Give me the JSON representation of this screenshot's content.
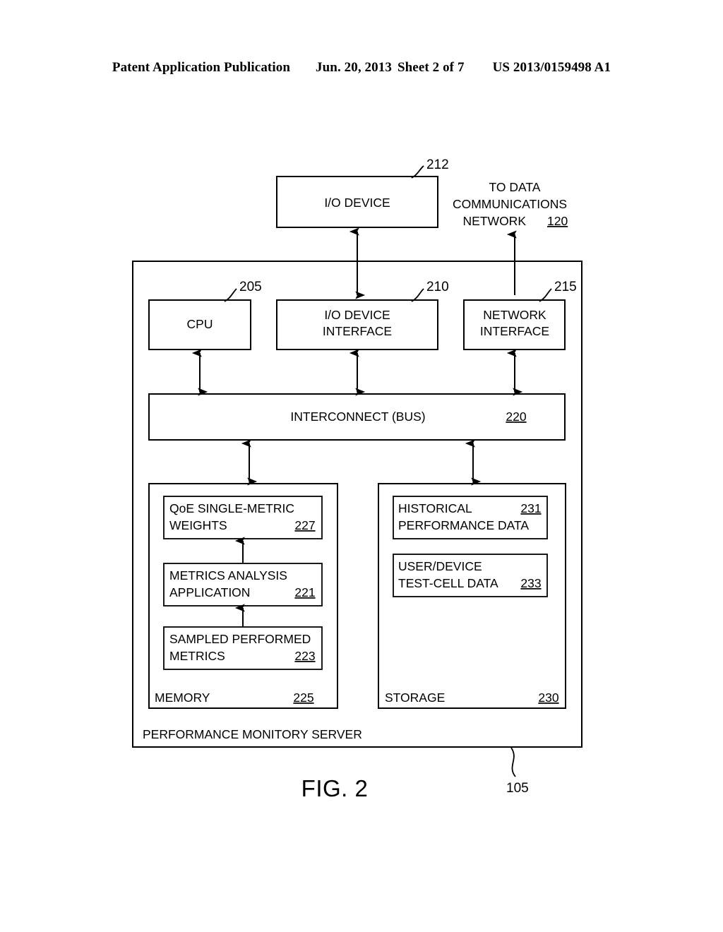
{
  "header": {
    "publication": "Patent Application Publication",
    "date": "Jun. 20, 2013",
    "sheet": "Sheet 2 of 7",
    "patent_number": "US 2013/0159498 A1"
  },
  "figure": {
    "caption": "FIG. 2",
    "server_label": "PERFORMANCE MONITORY SERVER",
    "server_ref": "105"
  },
  "blocks": {
    "io_device": {
      "label": "I/O DEVICE",
      "ref": "212"
    },
    "network_note": {
      "line1": "TO DATA",
      "line2": "COMMUNICATIONS",
      "line3": "NETWORK",
      "ref": "120"
    },
    "cpu": {
      "label": "CPU",
      "ref": "205"
    },
    "io_device_interface": {
      "line1": "I/O DEVICE",
      "line2": "INTERFACE",
      "ref": "210"
    },
    "network_interface": {
      "line1": "NETWORK",
      "line2": "INTERFACE",
      "ref": "215"
    },
    "interconnect": {
      "label": "INTERCONNECT (BUS)",
      "ref": "220"
    },
    "memory": {
      "label": "MEMORY",
      "ref": "225",
      "items": [
        {
          "line1": "QoE SINGLE-METRIC",
          "line2": "WEIGHTS",
          "ref": "227"
        },
        {
          "line1": "METRICS ANALYSIS",
          "line2": "APPLICATION",
          "ref": "221"
        },
        {
          "line1": "SAMPLED PERFORMED",
          "line2": "METRICS",
          "ref": "223"
        }
      ]
    },
    "storage": {
      "label": "STORAGE",
      "ref": "230",
      "items": [
        {
          "line1": "HISTORICAL",
          "line2": "PERFORMANCE DATA",
          "ref": "231"
        },
        {
          "line1": "USER/DEVICE",
          "line2": "TEST-CELL DATA",
          "ref": "233"
        }
      ]
    }
  }
}
